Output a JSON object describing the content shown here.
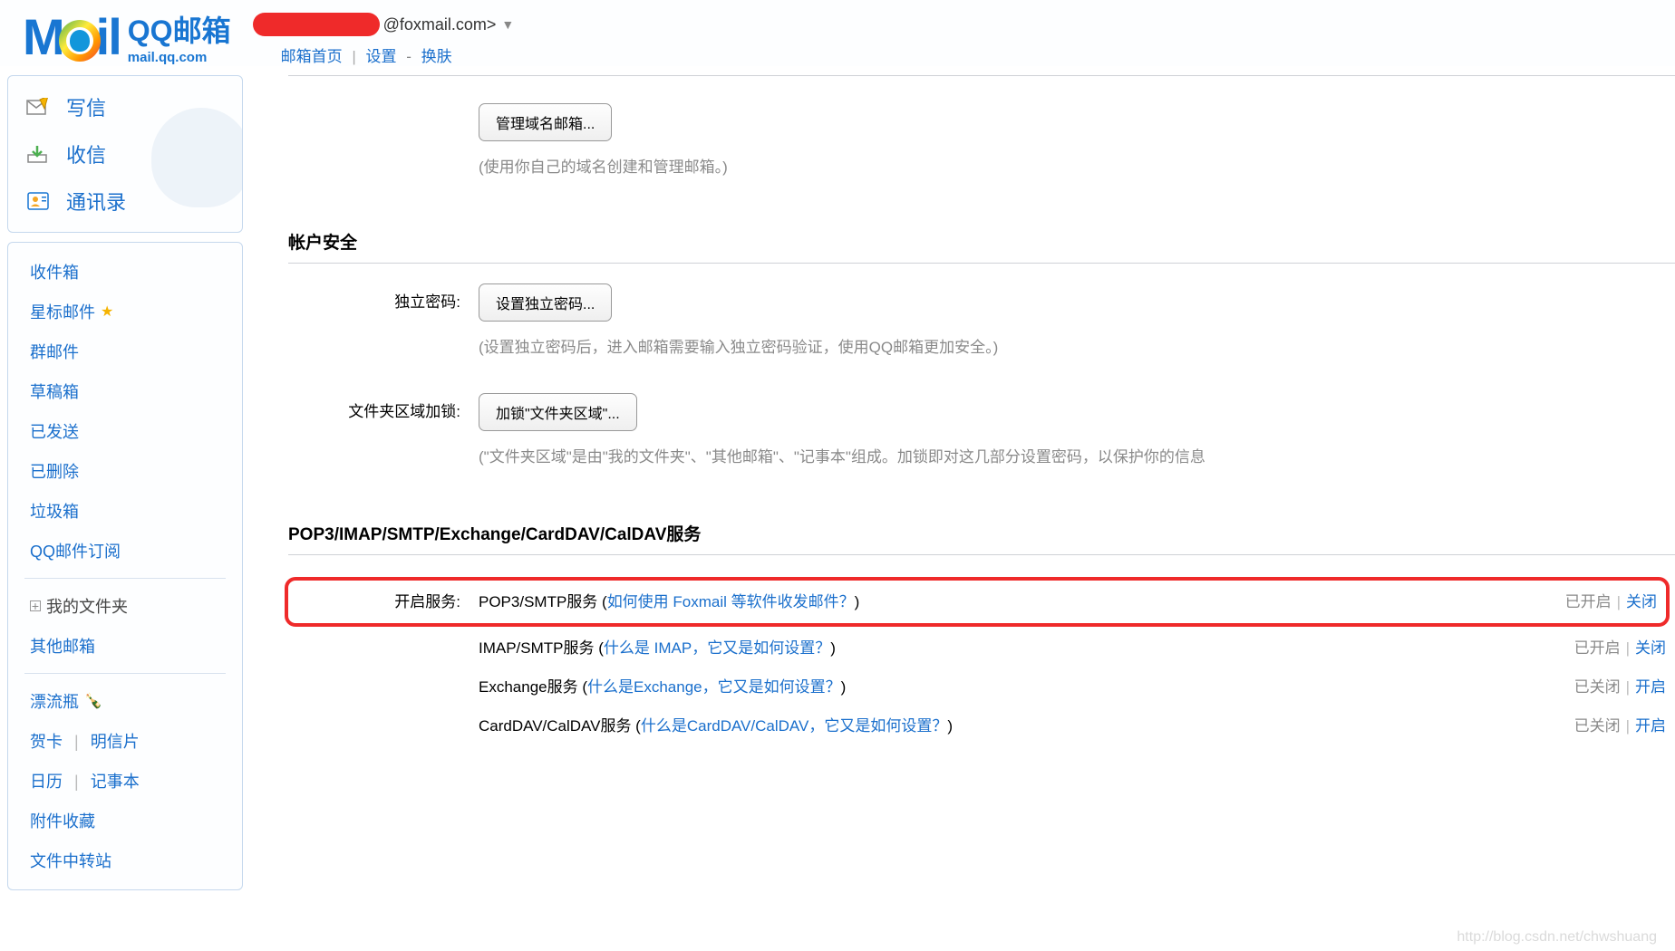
{
  "logo": {
    "mail_text": "Mail",
    "qq_text": "QQ邮箱",
    "domain": "mail.qq.com"
  },
  "header": {
    "email_suffix": "@foxmail.com>",
    "nav_home": "邮箱首页",
    "nav_settings": "设置",
    "nav_skin": "换肤"
  },
  "sidebar": {
    "compose": "写信",
    "receive": "收信",
    "contacts": "通讯录",
    "inbox": "收件箱",
    "starred": "星标邮件",
    "group": "群邮件",
    "drafts": "草稿箱",
    "sent": "已发送",
    "deleted": "已删除",
    "trash": "垃圾箱",
    "subscribe": "QQ邮件订阅",
    "myfolder": "我的文件夹",
    "other_mailbox": "其他邮箱",
    "drift": "漂流瓶",
    "card": "贺卡",
    "postcard": "明信片",
    "calendar": "日历",
    "notepad": "记事本",
    "attachments": "附件收藏",
    "filestation": "文件中转站"
  },
  "main": {
    "domain_mgmt": {
      "button": "管理域名邮箱...",
      "hint": "(使用你自己的域名创建和管理邮箱。)"
    },
    "account_security_title": "帐户安全",
    "password_row": {
      "label": "独立密码:",
      "button": "设置独立密码...",
      "hint": "(设置独立密码后，进入邮箱需要输入独立密码验证，使用QQ邮箱更加安全。)"
    },
    "folder_lock_row": {
      "label": "文件夹区域加锁:",
      "button": "加锁\"文件夹区域\"...",
      "hint": "(\"文件夹区域\"是由\"我的文件夹\"、\"其他邮箱\"、\"记事本\"组成。加锁即对这几部分设置密码，以保护你的信息"
    },
    "services_title": "POP3/IMAP/SMTP/Exchange/CardDAV/CalDAV服务",
    "services_label": "开启服务:",
    "status_on": "已开启",
    "status_off": "已关闭",
    "action_close": "关闭",
    "action_open": "开启",
    "services": [
      {
        "name": "POP3/SMTP服务 (",
        "link": "如何使用 Foxmail 等软件收发邮件？",
        "close": ")",
        "status": "已开启",
        "action": "关闭"
      },
      {
        "name": "IMAP/SMTP服务 (",
        "link": "什么是 IMAP，它又是如何设置？",
        "close": ")",
        "status": "已开启",
        "action": "关闭"
      },
      {
        "name": "Exchange服务 (",
        "link": "什么是Exchange，它又是如何设置？",
        "close": ")",
        "status": "已关闭",
        "action": "开启"
      },
      {
        "name": "CardDAV/CalDAV服务 (",
        "link": "什么是CardDAV/CalDAV，它又是如何设置？",
        "close": ")",
        "status": "已关闭",
        "action": "开启"
      }
    ]
  },
  "watermark": "http://blog.csdn.net/chwshuang"
}
